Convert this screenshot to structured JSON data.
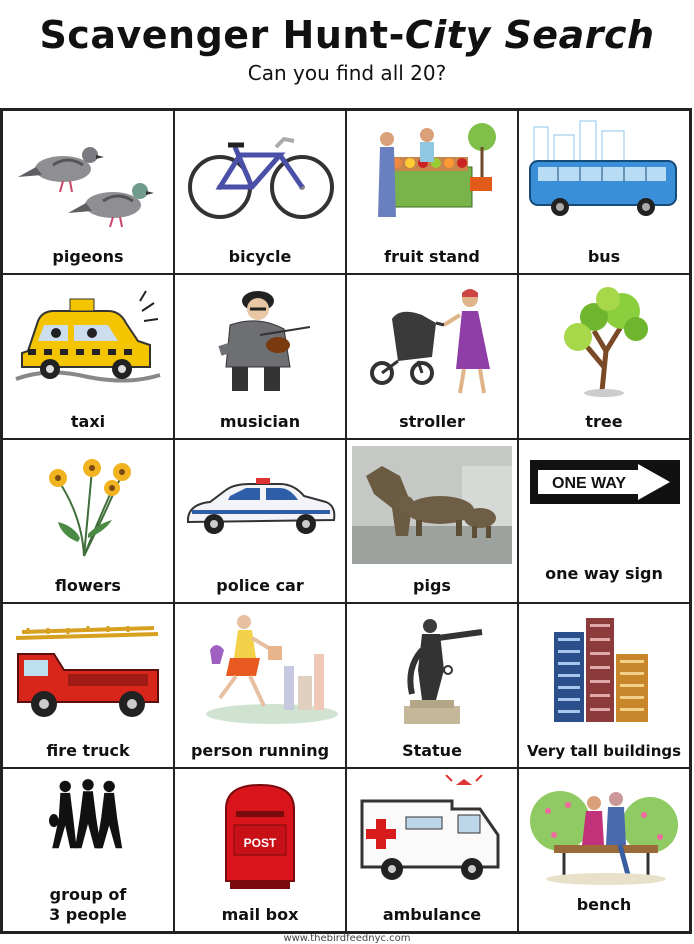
{
  "header": {
    "title_main": "Scavenger Hunt-",
    "title_italic": "City Search",
    "subtitle": "Can you find all 20?"
  },
  "items": [
    {
      "label": "pigeons",
      "icon": "pigeons-icon"
    },
    {
      "label": "bicycle",
      "icon": "bicycle-icon"
    },
    {
      "label": "fruit stand",
      "icon": "fruit-stand-icon"
    },
    {
      "label": "bus",
      "icon": "bus-icon"
    },
    {
      "label": "taxi",
      "icon": "taxi-icon"
    },
    {
      "label": "musician",
      "icon": "musician-icon"
    },
    {
      "label": "stroller",
      "icon": "stroller-icon"
    },
    {
      "label": "tree",
      "icon": "tree-icon"
    },
    {
      "label": "flowers",
      "icon": "flowers-icon"
    },
    {
      "label": "police car",
      "icon": "police-car-icon"
    },
    {
      "label": "pigs",
      "icon": "pigs-statue-icon"
    },
    {
      "label": "one way sign",
      "icon": "one-way-sign-icon",
      "sign_text": "ONE WAY"
    },
    {
      "label": "fire truck",
      "icon": "fire-truck-icon"
    },
    {
      "label": "person running",
      "icon": "person-running-icon"
    },
    {
      "label": "Statue",
      "icon": "statue-icon"
    },
    {
      "label": "Very tall buildings",
      "icon": "tall-buildings-icon"
    },
    {
      "label": "group of\n3 people",
      "icon": "group-of-people-icon"
    },
    {
      "label": "mail box",
      "icon": "mail-box-icon",
      "box_text": "POST"
    },
    {
      "label": "ambulance",
      "icon": "ambulance-icon"
    },
    {
      "label": "bench",
      "icon": "bench-icon"
    }
  ],
  "footer": {
    "credit": "www.thebirdfeednyc.com"
  },
  "colors": {
    "border": "#222222",
    "text": "#111111",
    "taxi": "#f5c400",
    "fire": "#d8261c",
    "bus": "#3a8fd8",
    "mailbox": "#d9141b"
  }
}
